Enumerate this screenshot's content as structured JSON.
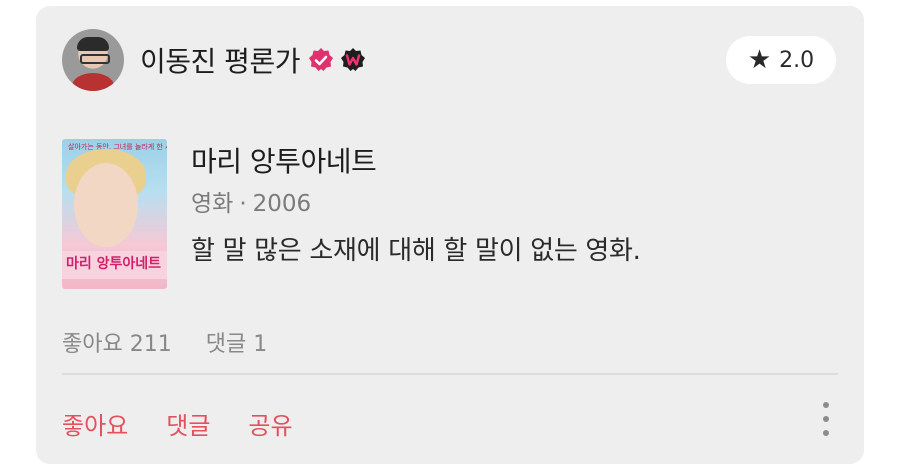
{
  "review": {
    "author": {
      "name": "이동진 평론가",
      "badges": [
        "verified-icon",
        "watcha-w-icon"
      ]
    },
    "rating": {
      "icon": "star-icon",
      "value": "2.0"
    },
    "movie": {
      "title": "마리 앙투아네트",
      "category": "영화",
      "separator": "·",
      "year": "2006",
      "poster": {
        "title_text": "마리 앙투아네트",
        "tagline": "살아가는 동안, 그녀를 놀라게 한 사랑과 운명"
      }
    },
    "text": "할 말 많은 소재에 대해 할 말이 없는 영화.",
    "stats": {
      "likes": "좋아요 211",
      "comments": "댓글 1"
    },
    "actions": {
      "like": "좋아요",
      "comment": "댓글",
      "share": "공유"
    }
  },
  "colors": {
    "accent": "#e4505d",
    "card_bg": "#eeeeef",
    "badge_pink": "#e0316e"
  }
}
